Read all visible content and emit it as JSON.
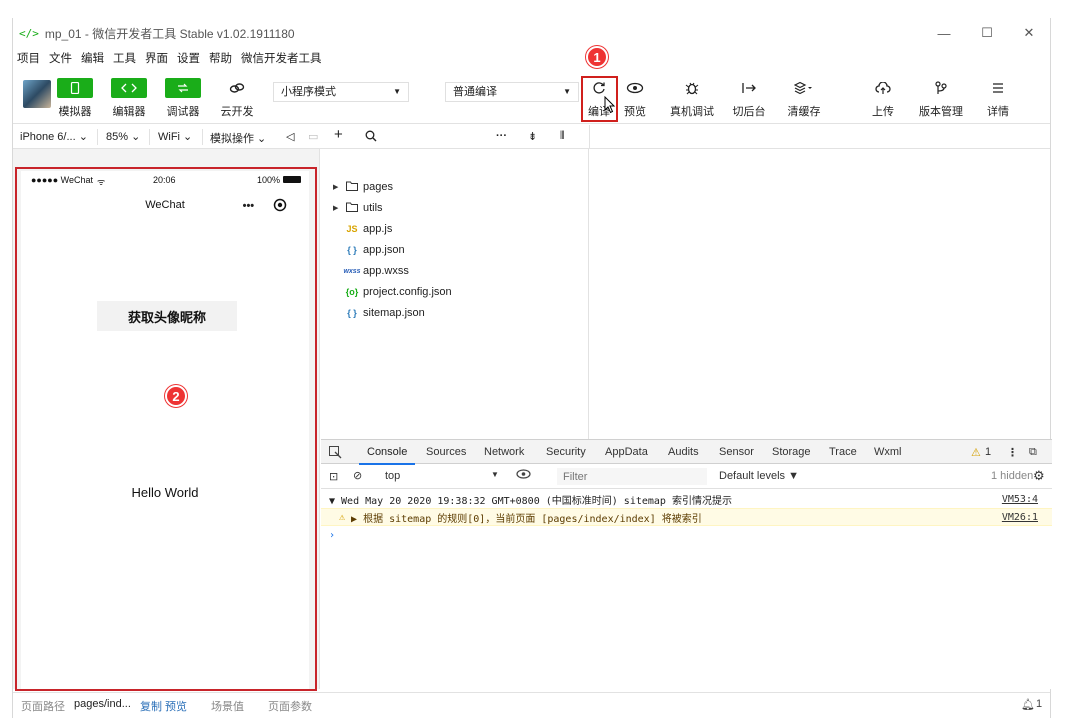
{
  "window": {
    "title": "mp_01 - 微信开发者工具 Stable v1.02.1911180",
    "logo": "</>",
    "controls": {
      "minimize": "—",
      "maximize": "☐",
      "close": "✕"
    }
  },
  "menu": [
    "项目",
    "文件",
    "编辑",
    "工具",
    "界面",
    "设置",
    "帮助",
    "微信开发者工具"
  ],
  "toolbar": {
    "simulator": "模拟器",
    "editor": "编辑器",
    "debugger": "调试器",
    "cloud": "云开发",
    "mode_select": "小程序模式",
    "compile_select": "普通编译",
    "compile": "编译",
    "preview": "预览",
    "device_debug": "真机调试",
    "background": "切后台",
    "clear_cache": "清缓存",
    "upload": "上传",
    "version": "版本管理",
    "details": "详情"
  },
  "subbar": {
    "device": "iPhone 6/...",
    "zoom": "85%",
    "network": "WiFi",
    "simulate": "模拟操作"
  },
  "phone": {
    "carrier": "●●●●● WeChat",
    "wifi": "ᯤ",
    "time": "20:06",
    "battery": "100%",
    "nav_title": "WeChat",
    "more": "•••",
    "button": "获取头像昵称",
    "hello": "Hello World"
  },
  "badges": {
    "one": "1",
    "two": "2"
  },
  "files": [
    {
      "name": "pages",
      "icon": "folder",
      "tri": "▶"
    },
    {
      "name": "utils",
      "icon": "folder",
      "tri": "▶"
    },
    {
      "name": "app.js",
      "icon": "JS",
      "tri": ""
    },
    {
      "name": "app.json",
      "icon": "{ }",
      "tri": ""
    },
    {
      "name": "app.wxss",
      "icon": "wxss",
      "tri": ""
    },
    {
      "name": "project.config.json",
      "icon": "{o}",
      "tri": ""
    },
    {
      "name": "sitemap.json",
      "icon": "{ }",
      "tri": ""
    }
  ],
  "devtools": {
    "tabs": [
      "Console",
      "Sources",
      "Network",
      "Security",
      "AppData",
      "Audits",
      "Sensor",
      "Storage",
      "Trace",
      "Wxml"
    ],
    "warn_count": "1",
    "context": "top",
    "filter_placeholder": "Filter",
    "levels": "Default levels ▼",
    "hidden": "1 hidden",
    "logs": [
      {
        "text": "▼ Wed May 20 2020 19:38:32 GMT+0800 (中国标准时间) sitemap 索引情况提示",
        "src": "VM53:4"
      },
      {
        "text": "▶ 根据 sitemap 的规则[0]，当前页面 [pages/index/index] 将被索引",
        "src": "VM26:1"
      }
    ],
    "prompt": "›"
  },
  "statusbar": {
    "path_label": "页面路径",
    "path": "pages/ind...",
    "copy": "复制",
    "preview": "预览",
    "scene": "场景值",
    "params": "页面参数",
    "notif": "1"
  },
  "colors": {
    "green": "#1aad19",
    "red": "#d0201d",
    "accent": "#1a73e8"
  }
}
